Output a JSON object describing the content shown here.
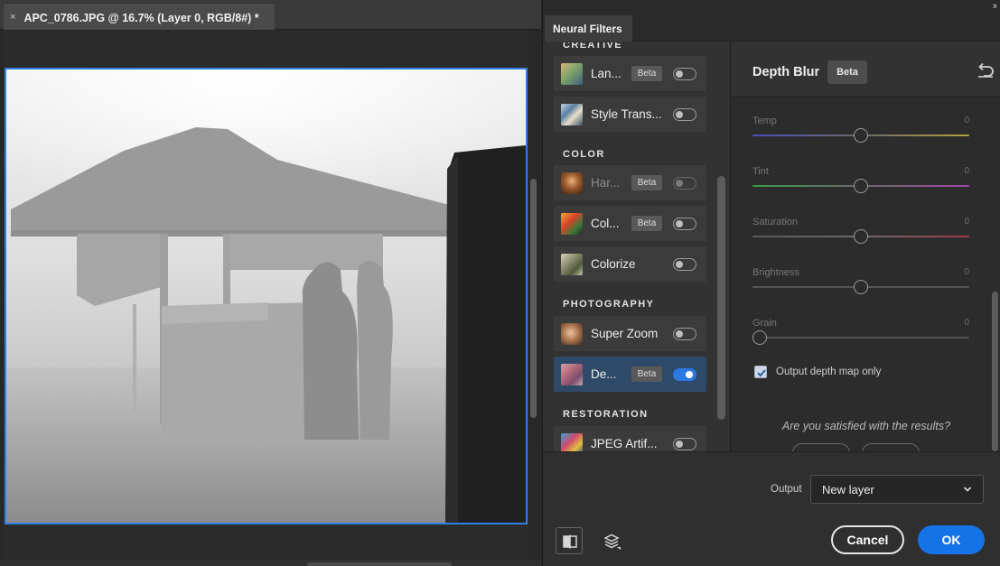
{
  "document": {
    "tab_title": "APC_0786.JPG @ 16.7% (Layer 0, RGB/8#) *",
    "close_glyph": "×"
  },
  "panel": {
    "tab_label": "Neural Filters",
    "sections": [
      {
        "label": "CREATIVE",
        "items": [
          {
            "name": "Lan...",
            "beta": "Beta",
            "enabled": false,
            "dimmed": false,
            "icon": "landscape-thumb"
          },
          {
            "name": "Style Trans...",
            "beta": null,
            "enabled": false,
            "dimmed": false,
            "icon": "style-transfer-thumb"
          }
        ]
      },
      {
        "label": "COLOR",
        "items": [
          {
            "name": "Har...",
            "beta": "Beta",
            "enabled": false,
            "dimmed": true,
            "icon": "harmonization-thumb"
          },
          {
            "name": "Col...",
            "beta": "Beta",
            "enabled": false,
            "dimmed": false,
            "icon": "color-transfer-thumb"
          },
          {
            "name": "Colorize",
            "beta": null,
            "enabled": false,
            "dimmed": false,
            "icon": "colorize-thumb"
          }
        ]
      },
      {
        "label": "PHOTOGRAPHY",
        "items": [
          {
            "name": "Super Zoom",
            "beta": null,
            "enabled": false,
            "dimmed": false,
            "icon": "super-zoom-thumb"
          },
          {
            "name": "De...",
            "beta": "Beta",
            "enabled": true,
            "dimmed": false,
            "active": true,
            "icon": "depth-blur-thumb"
          }
        ]
      },
      {
        "label": "RESTORATION",
        "items": [
          {
            "name": "JPEG Artif...",
            "beta": null,
            "enabled": false,
            "dimmed": false,
            "icon": "jpeg-artifacts-thumb"
          }
        ]
      }
    ]
  },
  "detail": {
    "title": "Depth Blur",
    "beta": "Beta",
    "sliders": [
      {
        "label": "Temp",
        "value": "0",
        "position": 0.5,
        "gradient": "temp"
      },
      {
        "label": "Tint",
        "value": "0",
        "position": 0.5,
        "gradient": "tint"
      },
      {
        "label": "Saturation",
        "value": "0",
        "position": 0.5,
        "gradient": "saturation"
      },
      {
        "label": "Brightness",
        "value": "0",
        "position": 0.5,
        "gradient": "gray"
      },
      {
        "label": "Grain",
        "value": "0",
        "position": 0.0,
        "gradient": "gray"
      }
    ],
    "output_depth_map_only": {
      "label": "Output depth map only",
      "checked": true
    },
    "satisfied_prompt": "Are you satisfied with the results?"
  },
  "bottom": {
    "output_label": "Output",
    "output_value": "New layer",
    "cancel_label": "Cancel",
    "ok_label": "OK"
  },
  "colors": {
    "accent": "#1473e6",
    "selection_border": "#2f80e0",
    "active_row": "#2f4a68"
  }
}
